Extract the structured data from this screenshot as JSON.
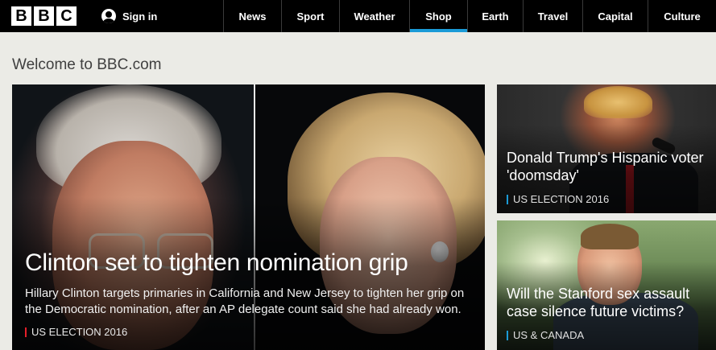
{
  "header": {
    "logo_letters": [
      "B",
      "B",
      "C"
    ],
    "signin_label": "Sign in",
    "nav": [
      {
        "label": "News",
        "active": false
      },
      {
        "label": "Sport",
        "active": false
      },
      {
        "label": "Weather",
        "active": false
      },
      {
        "label": "Shop",
        "active": true
      },
      {
        "label": "Earth",
        "active": false
      },
      {
        "label": "Travel",
        "active": false
      },
      {
        "label": "Capital",
        "active": false
      },
      {
        "label": "Culture",
        "active": false
      }
    ],
    "active_color": "#1b9bd7"
  },
  "welcome": "Welcome to BBC.com",
  "hero": {
    "title": "Clinton set to tighten nomination grip",
    "summary": "Hillary Clinton targets primaries in California and New Jersey to tighten her grip on the Democratic nomination, after an AP delegate count said she had already won.",
    "tag": "US ELECTION 2016",
    "tag_color": "#e51f2a"
  },
  "side_stories": [
    {
      "title": "Donald Trump's Hispanic voter 'doomsday'",
      "tag": "US ELECTION 2016",
      "tag_color": "#1b9bd7"
    },
    {
      "title": "Will the Stanford sex assault case silence future victims?",
      "tag": "US & CANADA",
      "tag_color": "#1b9bd7"
    }
  ]
}
